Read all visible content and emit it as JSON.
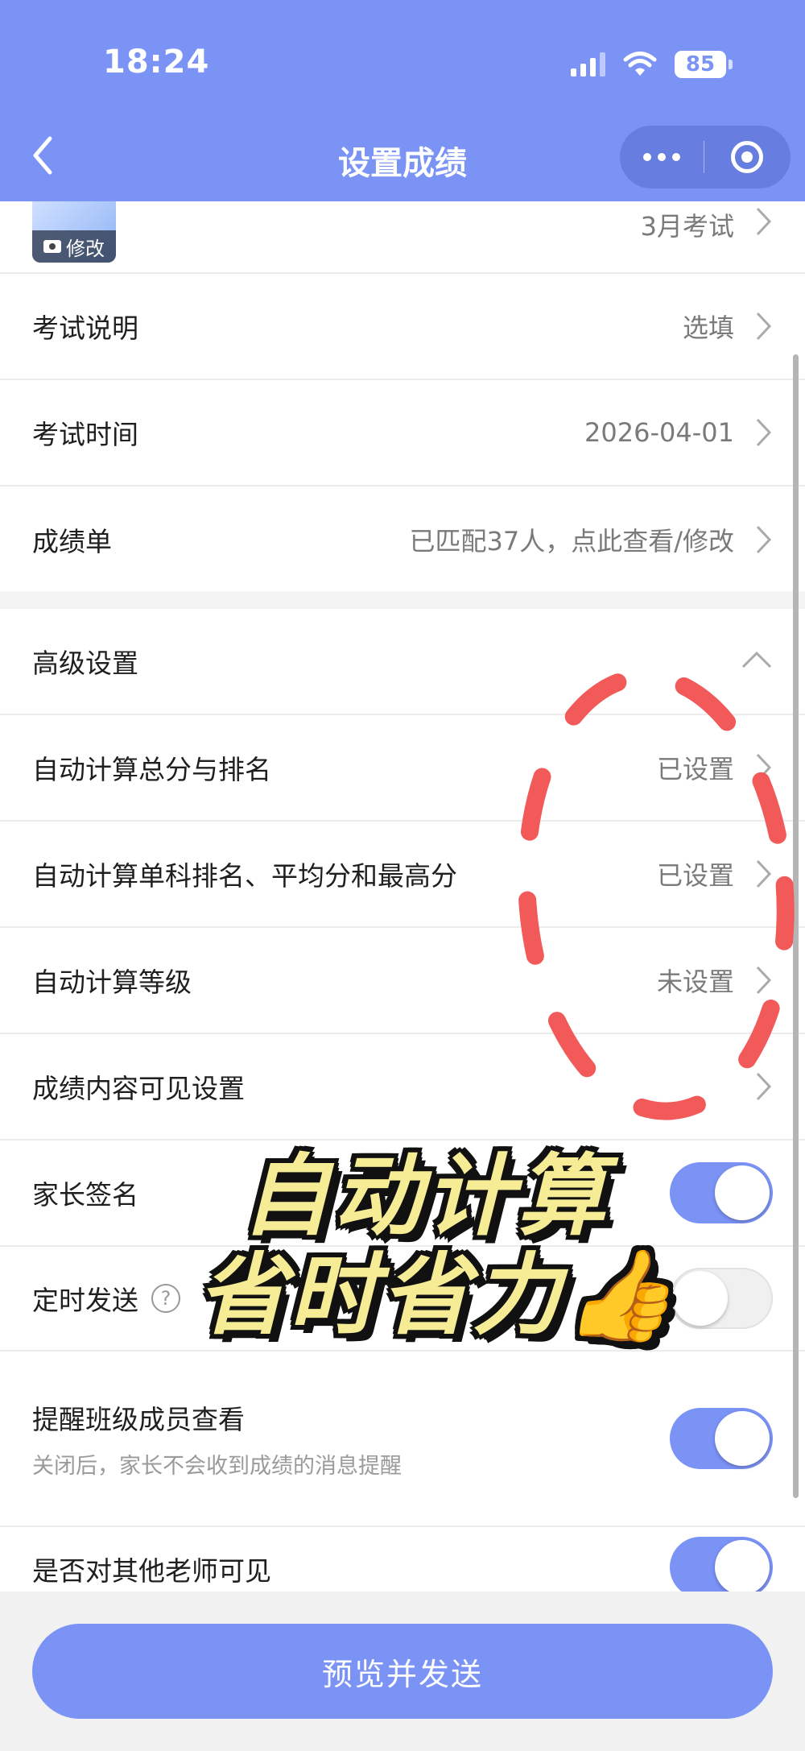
{
  "status_bar": {
    "time": "18:24",
    "battery": "85"
  },
  "nav": {
    "title": "设置成绩"
  },
  "thumbnail": {
    "edit_label": "修改"
  },
  "rows": {
    "exam_name": {
      "value": "3月考试"
    },
    "exam_desc": {
      "label": "考试说明",
      "value": "选填"
    },
    "exam_time": {
      "label": "考试时间",
      "value": "2026-04-01"
    },
    "score_sheet": {
      "label": "成绩单",
      "value": "已匹配37人，点此查看/修改"
    },
    "advanced": {
      "label": "高级设置"
    },
    "auto_total": {
      "label": "自动计算总分与排名",
      "value": "已设置"
    },
    "auto_single": {
      "label": "自动计算单科排名、平均分和最高分",
      "value": "已设置"
    },
    "auto_grade": {
      "label": "自动计算等级",
      "value": "未设置"
    },
    "visibility": {
      "label": "成绩内容可见设置"
    },
    "parent_sign": {
      "label": "家长签名",
      "enabled": true
    },
    "scheduled_send": {
      "label": "定时发送",
      "help": "?",
      "enabled": false
    },
    "remind_members": {
      "label": "提醒班级成员查看",
      "sub": "关闭后，家长不会收到成绩的消息提醒",
      "enabled": true
    },
    "visible_teachers": {
      "label": "是否对其他老师可见",
      "enabled": true
    }
  },
  "caption": {
    "line1": "自动计算",
    "line2": "省时省力👍"
  },
  "footer": {
    "button_label": "预览并发送"
  },
  "colors": {
    "accent": "#7b93f5",
    "annotation": "#f25a5a",
    "caption_text": "#f6ec95"
  }
}
